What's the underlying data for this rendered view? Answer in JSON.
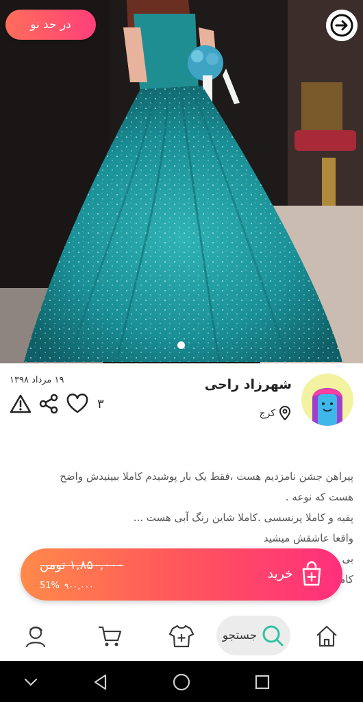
{
  "header": {
    "condition_badge": "در حد نو"
  },
  "seller": {
    "name": "شهرزاد راحی",
    "city": "کرج",
    "post_date": "۱۹ مرداد ۱۳۹۸",
    "like_count": "۳"
  },
  "description": {
    "lines": [
      "پیراهن جشن نامزدیم هست ،فقط یک بار پوشیدم کاملا ببینیدش واضح",
      "هست که نوعه .",
      "پفیه و کاملا پرنسسی .کاملا شاین رنگ  آبی هست ...",
      "واقعا عاشقش میشید",
      "بی",
      "کاملا"
    ]
  },
  "buy_bar": {
    "buy_label": "خرید",
    "old_price": "۱,۸۵۰,۰۰۰ تومن",
    "new_price": "۹۰۰,۰۰۰",
    "discount": "51%"
  },
  "bottom_nav": {
    "search_label": "جستجو"
  },
  "colors": {
    "accent_orange": "#ff8a4a",
    "accent_pink": "#ff2f7c",
    "search_green": "#2ec4a0"
  },
  "icons": [
    "arrow-right-icon",
    "pin-icon",
    "share-icon",
    "heart-icon",
    "warning-icon",
    "bag-plus-icon",
    "home-icon",
    "search-icon",
    "shirt-plus-icon",
    "cart-icon",
    "profile-icon"
  ]
}
